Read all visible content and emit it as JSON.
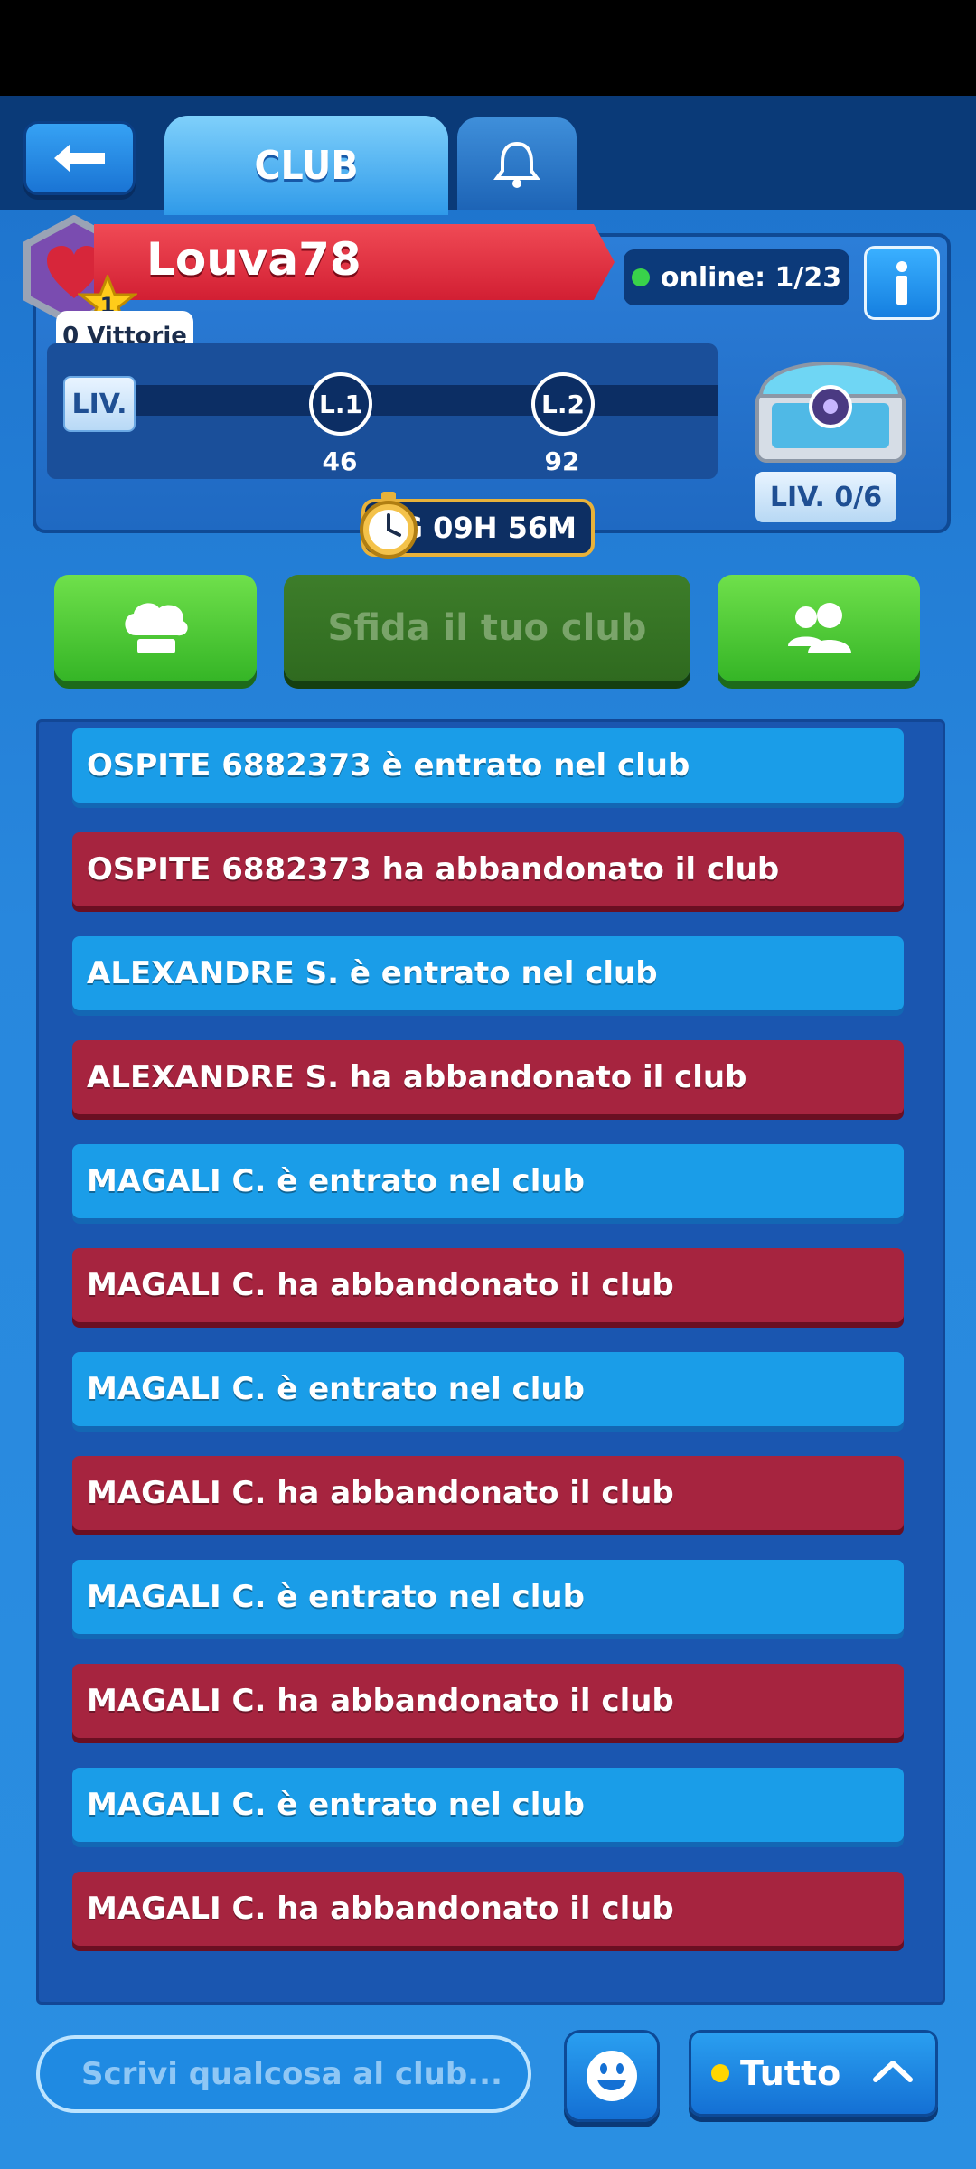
{
  "header": {
    "tab_club": "CLUB"
  },
  "club": {
    "name": "Louva78",
    "level_badge": "1",
    "wins": "0 Vittorie",
    "online": "online: 1/23",
    "level_tag": "LIV.",
    "levels": [
      {
        "label": "L.1",
        "value": "46"
      },
      {
        "label": "L.2",
        "value": "92"
      }
    ],
    "chest_level": "LIV. 0/6",
    "timer": "6G 09H 56M"
  },
  "actions": {
    "challenge": "Sfida il tuo club"
  },
  "feed": [
    {
      "text": "OSPITE 6882373 è entrato nel club",
      "type": "join"
    },
    {
      "text": "OSPITE 6882373 ha abbandonato il club",
      "type": "leave"
    },
    {
      "text": "ALEXANDRE S. è entrato nel club",
      "type": "join"
    },
    {
      "text": "ALEXANDRE S. ha abbandonato il club",
      "type": "leave"
    },
    {
      "text": "MAGALI C. è entrato nel club",
      "type": "join"
    },
    {
      "text": "MAGALI C. ha abbandonato il club",
      "type": "leave"
    },
    {
      "text": "MAGALI C. è entrato nel club",
      "type": "join"
    },
    {
      "text": "MAGALI C. ha abbandonato il club",
      "type": "leave"
    },
    {
      "text": "MAGALI C. è entrato nel club",
      "type": "join"
    },
    {
      "text": "MAGALI C. ha abbandonato il club",
      "type": "leave"
    },
    {
      "text": "MAGALI C. è entrato nel club",
      "type": "join"
    },
    {
      "text": "MAGALI C. ha abbandonato il club",
      "type": "leave"
    }
  ],
  "chat": {
    "placeholder": "Scrivi qualcosa al club...",
    "filter_label": "Tutto"
  },
  "colors": {
    "join": "#1a9de8",
    "leave": "#a6243f",
    "online_dot": "#39d24a",
    "banner": "#d21f33"
  }
}
